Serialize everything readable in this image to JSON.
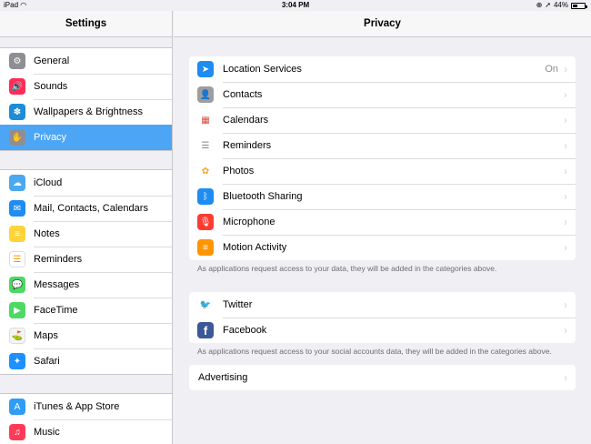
{
  "status": {
    "device": "iPad",
    "time": "3:04 PM",
    "battery": "44%",
    "battery_level": 0.44
  },
  "sidebar": {
    "title": "Settings",
    "groups": [
      [
        {
          "label": "General",
          "icon": "gear-icon",
          "color": "#8e8e93",
          "glyph": "⚙"
        },
        {
          "label": "Sounds",
          "icon": "speaker-icon",
          "color": "#ff2d55",
          "glyph": "🔊"
        },
        {
          "label": "Wallpapers & Brightness",
          "icon": "flower-icon",
          "color": "#1e8cd8",
          "glyph": "✽"
        },
        {
          "label": "Privacy",
          "icon": "hand-icon",
          "color": "#8e8e93",
          "glyph": "✋",
          "selected": true
        }
      ],
      [
        {
          "label": "iCloud",
          "icon": "cloud-icon",
          "color": "#4aa8f0",
          "glyph": "☁"
        },
        {
          "label": "Mail, Contacts, Calendars",
          "icon": "envelope-icon",
          "color": "#1e8cf0",
          "glyph": "✉"
        },
        {
          "label": "Notes",
          "icon": "notepad-icon",
          "color": "#fed33b",
          "glyph": "≡"
        },
        {
          "label": "Reminders",
          "icon": "list-icon",
          "color": "#ffffff",
          "glyph": "☰"
        },
        {
          "label": "Messages",
          "icon": "speech-bubble-icon",
          "color": "#4cd964",
          "glyph": "💬"
        },
        {
          "label": "FaceTime",
          "icon": "video-camera-icon",
          "color": "#4cd964",
          "glyph": "▶"
        },
        {
          "label": "Maps",
          "icon": "map-icon",
          "color": "#f4f4f4",
          "glyph": "⛳"
        },
        {
          "label": "Safari",
          "icon": "compass-icon",
          "color": "#1e90ff",
          "glyph": "✦"
        }
      ],
      [
        {
          "label": "iTunes & App Store",
          "icon": "app-store-icon",
          "color": "#2f9cf5",
          "glyph": "A"
        },
        {
          "label": "Music",
          "icon": "music-note-icon",
          "color": "#ff3b58",
          "glyph": "♫"
        }
      ]
    ]
  },
  "main": {
    "title": "Privacy",
    "group1": [
      {
        "label": "Location Services",
        "value": "On",
        "icon": "location-arrow-icon",
        "color": "#1e8cf0",
        "glyph": "➤"
      },
      {
        "label": "Contacts",
        "icon": "contacts-icon",
        "color": "#9e9e9e",
        "glyph": "👤"
      },
      {
        "label": "Calendars",
        "icon": "calendar-icon",
        "color": "#ffffff",
        "glyph": "▦"
      },
      {
        "label": "Reminders",
        "icon": "list-icon",
        "color": "#ffffff",
        "glyph": "☰"
      },
      {
        "label": "Photos",
        "icon": "photos-flower-icon",
        "color": "#ffffff",
        "glyph": "✿"
      },
      {
        "label": "Bluetooth Sharing",
        "icon": "bluetooth-icon",
        "color": "#1e8cf0",
        "glyph": "ᛒ"
      },
      {
        "label": "Microphone",
        "icon": "microphone-icon",
        "color": "#ff3b30",
        "glyph": "🎙"
      },
      {
        "label": "Motion Activity",
        "icon": "motion-icon",
        "color": "#ff9500",
        "glyph": "≡"
      }
    ],
    "note1": "As applications request access to your data, they will be added in the categories above.",
    "group2": [
      {
        "label": "Twitter",
        "icon": "twitter-bird-icon",
        "color": "#ffffff",
        "glyph": "🐦"
      },
      {
        "label": "Facebook",
        "icon": "facebook-icon",
        "color": "#3b5998",
        "glyph": "f"
      }
    ],
    "note2": "As applications request access to your social accounts data, they will be added in the categories above.",
    "advertising": "Advertising"
  }
}
